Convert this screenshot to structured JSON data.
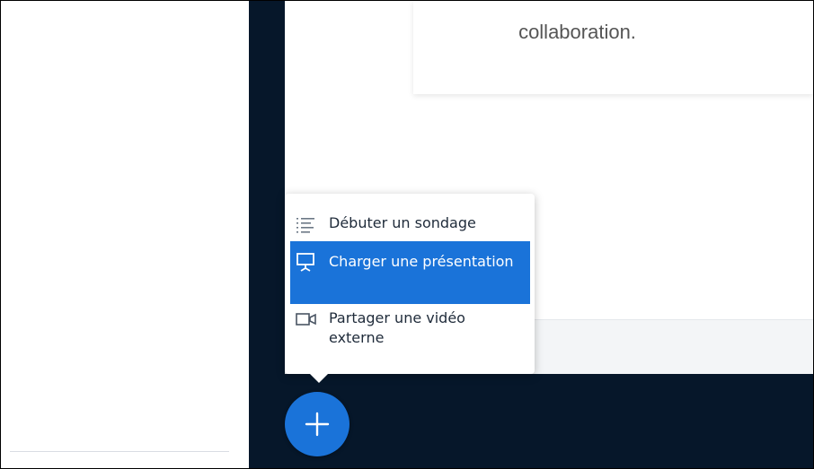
{
  "slide": {
    "text": "collaboration."
  },
  "actions_menu": {
    "items": [
      {
        "label": "Débuter un sondage",
        "icon": "poll-list-icon"
      },
      {
        "label": "Charger une présentation",
        "icon": "presentation-icon",
        "selected": true
      },
      {
        "label": "Partager une vidéo externe",
        "icon": "video-camera-icon"
      }
    ]
  },
  "fab": {
    "icon": "plus-icon"
  },
  "colors": {
    "accent": "#1a73d9",
    "dark_bg": "#06172a"
  }
}
